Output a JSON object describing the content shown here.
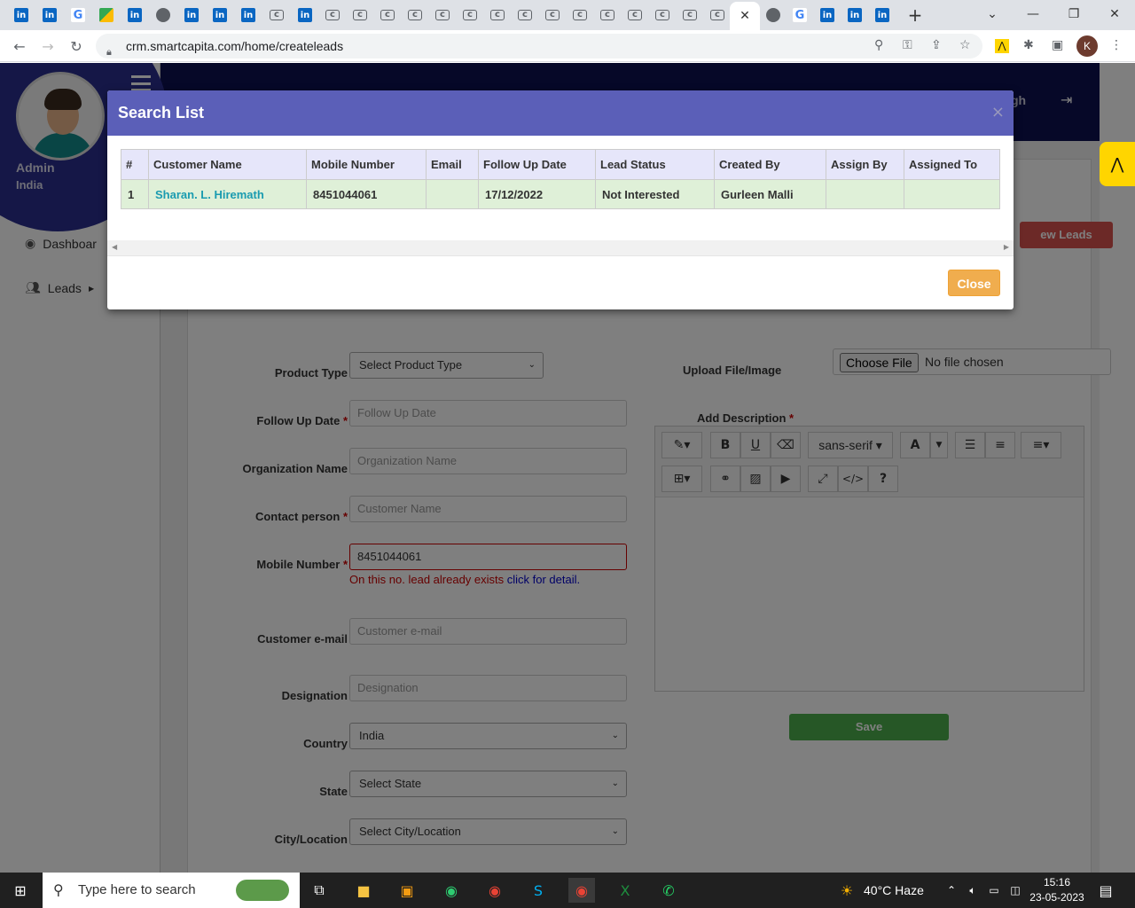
{
  "browser": {
    "url": "crm.smartcapita.com/home/createleads",
    "profile_initial": "K"
  },
  "topnav": {
    "user_fragment": "gh"
  },
  "sidebar": {
    "user_name": "Admin",
    "user_country": "India",
    "items": [
      {
        "label": "Dashboar",
        "icon": "palette-icon"
      },
      {
        "label": "Leads",
        "icon": "users-icon"
      }
    ]
  },
  "form": {
    "new_leads_label": "ew Leads",
    "upload_label": "Upload File/Image",
    "choose_file_label": "Choose File",
    "no_file_text": "No file chosen",
    "description_label": "Add Description",
    "product_type": {
      "label": "Product Type",
      "value": "Select Product Type"
    },
    "follow_up_date": {
      "label": "Follow Up Date",
      "placeholder": "Follow Up Date"
    },
    "organization_name": {
      "label": "Organization Name",
      "placeholder": "Organization Name"
    },
    "contact_person": {
      "label": "Contact person",
      "placeholder": "Customer Name"
    },
    "mobile_number": {
      "label": "Mobile Number",
      "value": "8451044061",
      "error": "On this no. lead already exists ",
      "error_link": "click for detail."
    },
    "customer_email": {
      "label": "Customer e-mail",
      "placeholder": "Customer e-mail"
    },
    "designation": {
      "label": "Designation",
      "placeholder": "Designation"
    },
    "country": {
      "label": "Country",
      "value": "India"
    },
    "state": {
      "label": "State",
      "value": "Select State"
    },
    "city": {
      "label": "City/Location",
      "value": "Select City/Location"
    },
    "editor_font": "sans-serif",
    "save_label": "Save"
  },
  "modal": {
    "title": "Search List",
    "close_x": "×",
    "columns": [
      "#",
      "Customer Name",
      "Mobile Number",
      "Email",
      "Follow Up Date",
      "Lead Status",
      "Created By",
      "Assign By",
      "Assigned To"
    ],
    "rows": [
      [
        "1",
        "Sharan. L. Hiremath",
        "8451044061",
        "",
        "17/12/2022",
        "Not Interested",
        "Gurleen Malli",
        "",
        ""
      ]
    ],
    "close_button_label": "Close"
  },
  "taskbar": {
    "search_placeholder": "Type here to search",
    "weather": "40°C  Haze",
    "time": "15:16",
    "date": "23-05-2023"
  }
}
